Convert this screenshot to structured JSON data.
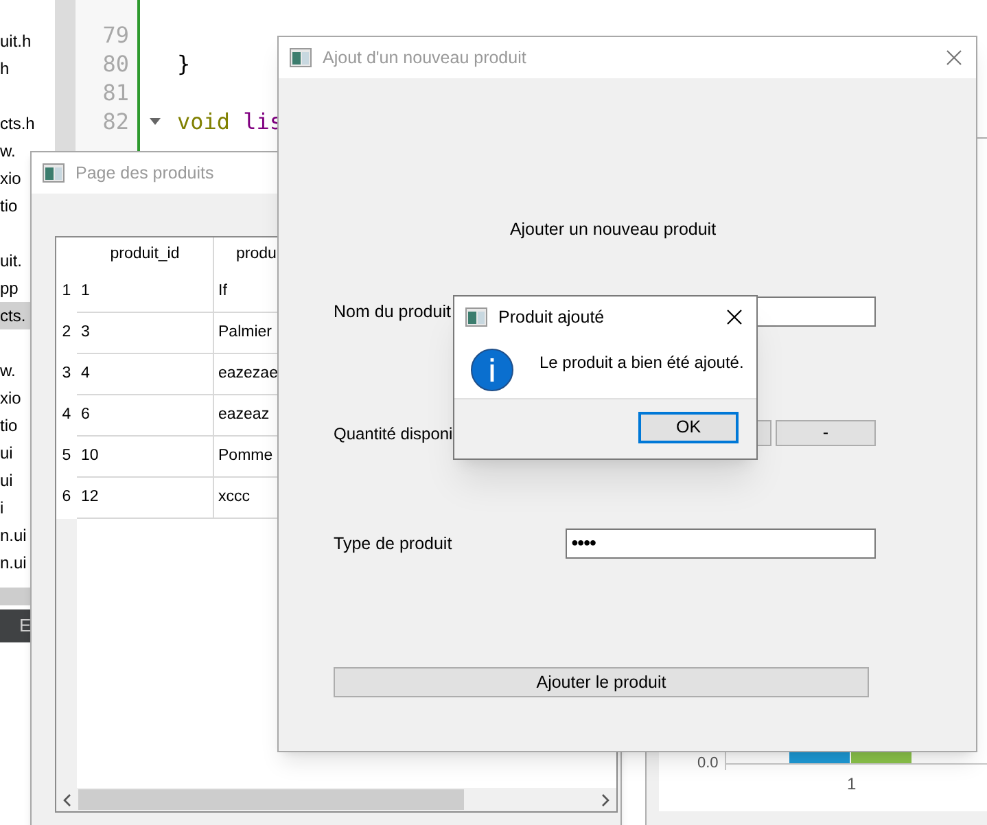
{
  "ide": {
    "file_groups": [
      [
        {
          "name": "uit.h",
          "selected": false
        },
        {
          "name": "h",
          "selected": false
        }
      ],
      [
        {
          "name": "cts.h",
          "selected": false
        },
        {
          "name": "w.",
          "selected": false
        },
        {
          "name": "xio",
          "selected": false
        },
        {
          "name": "tio",
          "selected": false
        }
      ],
      [
        {
          "name": "uit.",
          "selected": false
        },
        {
          "name": "pp",
          "selected": false
        },
        {
          "name": "cts.",
          "selected": true
        }
      ],
      [
        {
          "name": "w.",
          "selected": false
        },
        {
          "name": "xio",
          "selected": false
        },
        {
          "name": "tio",
          "selected": false
        },
        {
          "name": "ui",
          "selected": false
        },
        {
          "name": "ui",
          "selected": false
        },
        {
          "name": "i",
          "selected": false
        },
        {
          "name": "n.ui",
          "selected": false
        },
        {
          "name": "n.ui",
          "selected": false
        }
      ]
    ],
    "bottom_tab": "E",
    "code_lines": [
      {
        "number": "79",
        "foldable": false
      },
      {
        "number": "80",
        "foldable": false,
        "tokens": [
          {
            "text": "}",
            "kind": "plain"
          }
        ]
      },
      {
        "number": "81",
        "foldable": false
      },
      {
        "number": "82",
        "foldable": true,
        "tokens": [
          {
            "text": "void",
            "kind": "keyword"
          },
          {
            "text": " lis",
            "kind": "function"
          }
        ]
      }
    ]
  },
  "chart_window": {
    "y_tick": "0.0",
    "category": "1",
    "bars": [
      {
        "color": "#1e9ad6"
      },
      {
        "color": "#8bc34a"
      }
    ]
  },
  "products_window": {
    "title": "Page des produits",
    "active": false,
    "table": {
      "columns": [
        "produit_id",
        "produ"
      ],
      "rows": [
        {
          "header": "1",
          "cells": [
            "1",
            "If"
          ]
        },
        {
          "header": "2",
          "cells": [
            "3",
            "Palmier"
          ]
        },
        {
          "header": "3",
          "cells": [
            "4",
            "eazezae"
          ]
        },
        {
          "header": "4",
          "cells": [
            "6",
            "eazeaz"
          ]
        },
        {
          "header": "5",
          "cells": [
            "10",
            "Pomme"
          ]
        },
        {
          "header": "6",
          "cells": [
            "12",
            "xccc"
          ]
        }
      ]
    }
  },
  "add_dialog": {
    "title": "Ajout d'un nouveau produit",
    "active": false,
    "heading": "Ajouter un nouveau produit",
    "name_label": "Nom du produit",
    "quantity_label": "Quantité disponi",
    "quantity_buttons": [
      {
        "kind": "covered"
      },
      {
        "kind": "labelled",
        "label": "-"
      }
    ],
    "type_label": "Type de produit",
    "type_value": "●●●●",
    "submit": "Ajouter le produit"
  },
  "message_box": {
    "title": "Produit ajouté",
    "active": true,
    "message": "Le produit a bien été ajouté.",
    "button": "OK"
  }
}
